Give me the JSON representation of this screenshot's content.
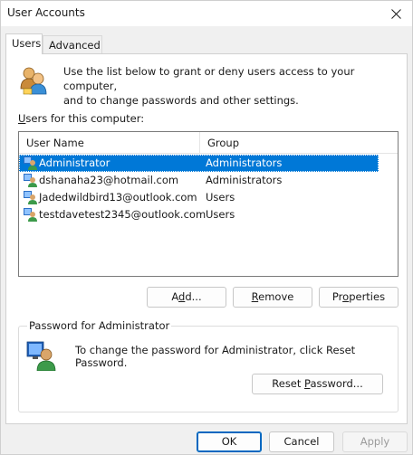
{
  "window": {
    "title": "User Accounts"
  },
  "tabs": [
    {
      "label": "Users",
      "active": true
    },
    {
      "label": "Advanced",
      "active": false
    }
  ],
  "intro": {
    "text_line1": "Use the list below to grant or deny users access to your computer,",
    "text_line2": "and to change passwords and other settings."
  },
  "users_section": {
    "label_prefix": "",
    "label_accel": "U",
    "label_rest": "sers for this computer:"
  },
  "list": {
    "columns": [
      "User Name",
      "Group"
    ],
    "rows": [
      {
        "name": "Administrator",
        "group": "Administrators",
        "selected": true
      },
      {
        "name": "dshanaha23@hotmail.com",
        "group": "Administrators",
        "selected": false
      },
      {
        "name": "Jadedwildbird13@outlook.com",
        "group": "Users",
        "selected": false
      },
      {
        "name": "testdavetest2345@outlook.com",
        "group": "Users",
        "selected": false
      }
    ]
  },
  "buttons": {
    "add_accel": "d",
    "add_pre": "A",
    "add_post": "d...",
    "remove_accel": "R",
    "remove_post": "emove",
    "properties_pre": "Pr",
    "properties_accel": "o",
    "properties_post": "perties"
  },
  "password": {
    "legend": "Password for Administrator",
    "text": "To change the password for Administrator, click Reset Password.",
    "reset_pre": "Reset ",
    "reset_accel": "P",
    "reset_post": "assword..."
  },
  "dialog_buttons": {
    "ok": "OK",
    "cancel": "Cancel",
    "apply": "Apply"
  },
  "colors": {
    "selection": "#0078d7",
    "default_button_border": "#0067c0"
  }
}
